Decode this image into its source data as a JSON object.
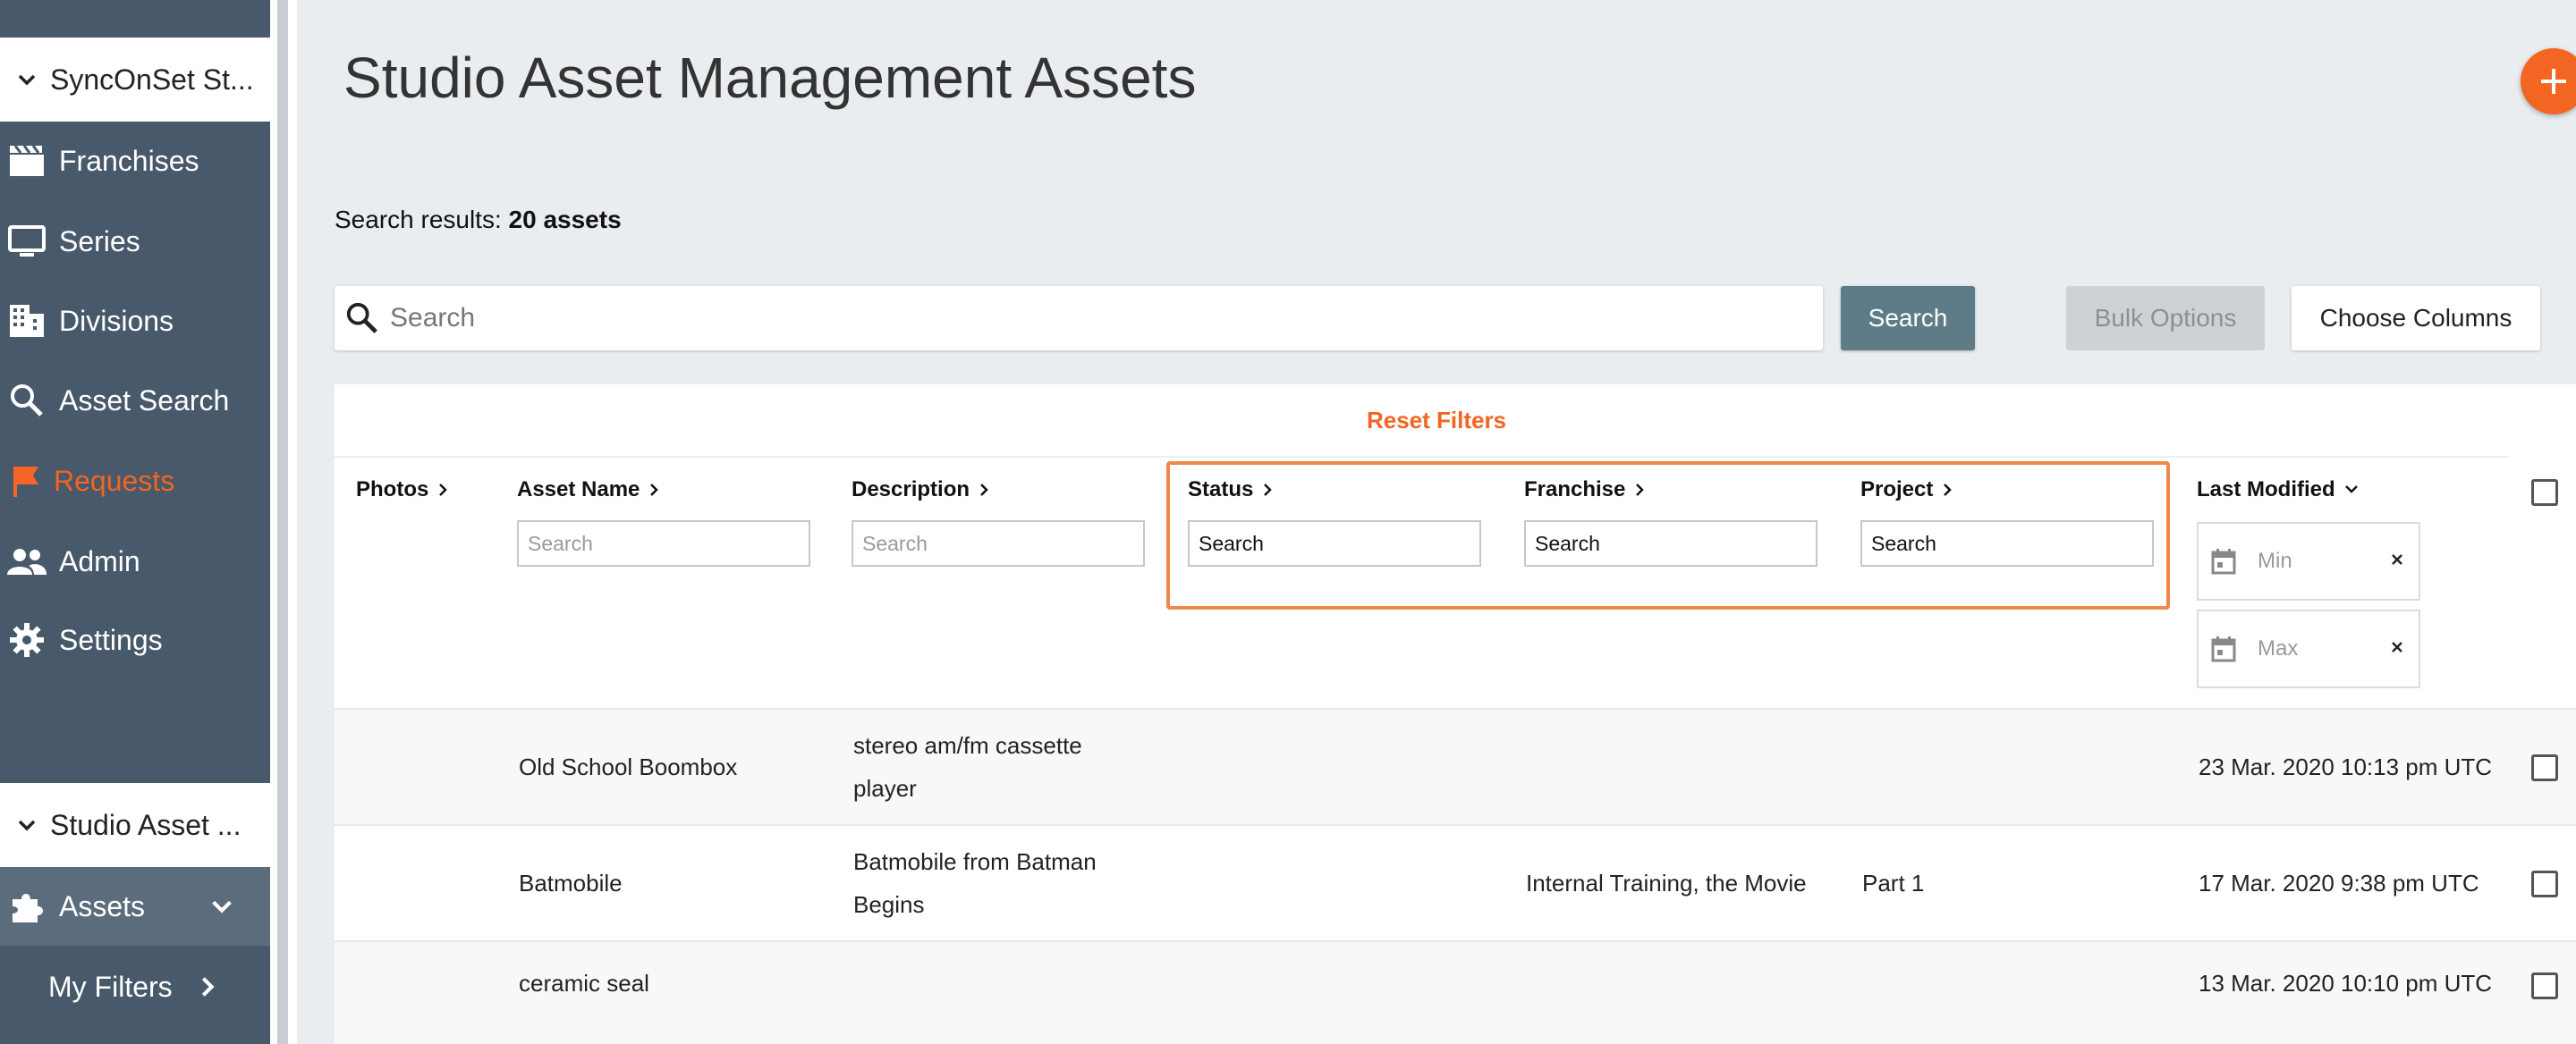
{
  "sidebar": {
    "org_selector": "SyncOnSet St...",
    "items": [
      {
        "label": "Franchises",
        "icon": "clapperboard-icon"
      },
      {
        "label": "Series",
        "icon": "monitor-icon"
      },
      {
        "label": "Divisions",
        "icon": "building-icon"
      },
      {
        "label": "Asset Search",
        "icon": "search-icon"
      },
      {
        "label": "Requests",
        "icon": "flag-icon",
        "active": true
      },
      {
        "label": "Admin",
        "icon": "people-icon"
      },
      {
        "label": "Settings",
        "icon": "gear-icon"
      }
    ],
    "app_selector": "Studio Asset ...",
    "assets_label": "Assets",
    "my_filters_label": "My Filters"
  },
  "main": {
    "title": "Studio Asset Management Assets",
    "results_prefix": "Search results:",
    "results_count": "20 assets",
    "search": {
      "placeholder": "Search",
      "button": "Search"
    },
    "bulk_options": "Bulk Options",
    "choose_columns": "Choose Columns",
    "reset_filters": "Reset Filters"
  },
  "table": {
    "columns": {
      "photos": "Photos",
      "asset_name": "Asset Name",
      "description": "Description",
      "status": "Status",
      "franchise": "Franchise",
      "project": "Project",
      "last_modified": "Last Modified"
    },
    "filters": {
      "asset_name": "Search",
      "description": "Search",
      "status": "Search",
      "franchise": "Search",
      "project": "Search",
      "date_min": "Min",
      "date_max": "Max"
    },
    "rows": [
      {
        "name": "Old School Boombox",
        "desc1": "stereo am/fm cassette",
        "desc2": "player",
        "franchise": "",
        "project": "",
        "modified": "23 Mar. 2020 10:13 pm UTC"
      },
      {
        "name": "Batmobile",
        "desc1": "Batmobile from Batman",
        "desc2": "Begins",
        "franchise": "Internal Training, the Movie",
        "project": "Part 1",
        "modified": "17 Mar. 2020 9:38 pm UTC"
      },
      {
        "name": "ceramic seal",
        "desc1": "",
        "desc2": "",
        "franchise": "",
        "project": "",
        "modified": "13 Mar. 2020 10:10 pm UTC"
      }
    ]
  },
  "colors": {
    "accent": "#f26522",
    "sidebar": "#47596a",
    "search_button": "#5e7c88"
  }
}
